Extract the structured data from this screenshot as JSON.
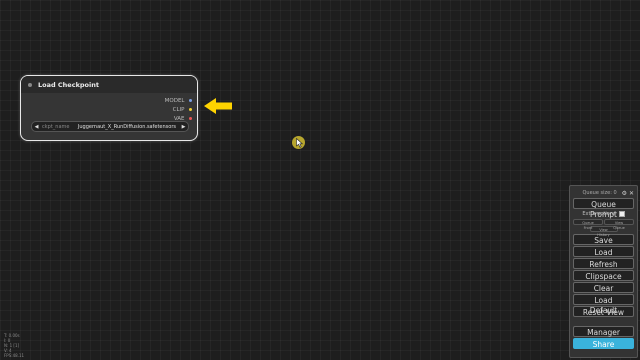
{
  "node": {
    "title": "Load Checkpoint",
    "outputs": [
      {
        "label": "MODEL",
        "color": "#7aa0e6"
      },
      {
        "label": "CLIP",
        "color": "#f0d030"
      },
      {
        "label": "VAE",
        "color": "#ee5555"
      }
    ],
    "widget": {
      "label": "ckpt_name",
      "value": "Juggernaut_X_RunDiffusion.safetensors",
      "left": "◀",
      "right": "▶"
    }
  },
  "annotation_arrow_color": "#ffd400",
  "stats": [
    "T: 0.00s",
    "I: 0",
    "N: 1 [1]",
    "V: 4",
    "FPS:48.11"
  ],
  "panel": {
    "queue_size_label": "Queue size: 0",
    "icons": "⚙ ✕",
    "queue_prompt": "Queue Prompt",
    "extra_options": "Extra options",
    "queue_front": "Queue Front",
    "view_queue": "View Queue",
    "view_history": "View History",
    "buttons": [
      "Save",
      "Load",
      "Refresh",
      "Clipspace",
      "Clear",
      "Load Default",
      "Reset View"
    ],
    "manager": "Manager",
    "share": "Share",
    "share_color": "#3ab3dc"
  }
}
